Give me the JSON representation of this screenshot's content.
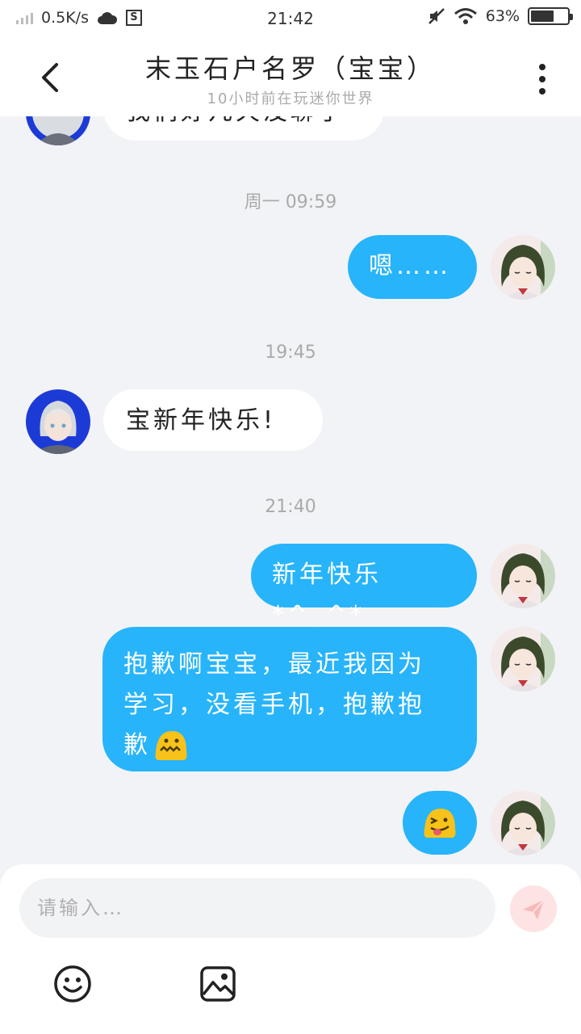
{
  "status_bar": {
    "net_speed": "0.5K/s",
    "time": "21:42",
    "battery": "63%",
    "battery_level": 0.63
  },
  "header": {
    "title": "末玉石户名罗（宝宝）",
    "subtitle": "10小时前在玩迷你世界"
  },
  "messages": {
    "partial_text": "我们好几天没聊了",
    "time1": "周一 09:59",
    "out1": "嗯……",
    "time2": "19:45",
    "in1": "宝新年快乐!",
    "time3": "21:40",
    "out2": "新年快乐*^_^*",
    "out3_line1": "抱歉啊宝宝，最近我因为",
    "out3_line2": "学习，没看手机，抱歉抱",
    "out3_line3": "歉"
  },
  "composer": {
    "placeholder": "请输入…"
  },
  "colors": {
    "accent": "#27b4fb",
    "background": "#f2f3f6",
    "send_disabled": "#fde3e3"
  }
}
